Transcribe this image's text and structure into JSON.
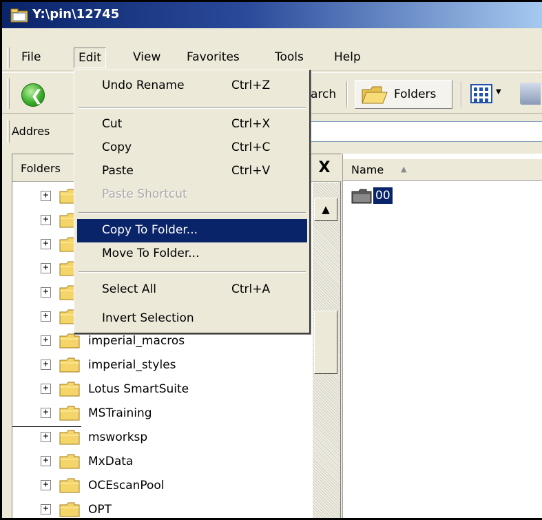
{
  "window": {
    "title": "Y:\\pin\\12745",
    "icon": "folder-window-icon"
  },
  "menubar": {
    "items": [
      "File",
      "Edit",
      "View",
      "Favorites",
      "Tools",
      "Help"
    ],
    "active": "Edit"
  },
  "toolbar": {
    "back_icon": "back-arrow-icon",
    "back_label_fragment": "",
    "search_fragment": "arch",
    "folders_label": "Folders",
    "views_icon": "views-icon"
  },
  "address": {
    "label": "Addres",
    "value": ""
  },
  "folders_pane": {
    "title": "Folders",
    "close_glyph": "X",
    "items": [
      {
        "label": "",
        "expander": "+"
      },
      {
        "label": "",
        "expander": "+"
      },
      {
        "label": "",
        "expander": "+"
      },
      {
        "label": "",
        "expander": "+"
      },
      {
        "label": "",
        "expander": "+"
      },
      {
        "label": "",
        "expander": "+"
      },
      {
        "label": "imperial_macros",
        "expander": "+"
      },
      {
        "label": "imperial_styles",
        "expander": "+"
      },
      {
        "label": "Lotus SmartSuite",
        "expander": "+"
      },
      {
        "label": "MSTraining",
        "expander": "+"
      },
      {
        "label": "msworksp",
        "expander": "+"
      },
      {
        "label": "MxData",
        "expander": "+"
      },
      {
        "label": "OCEscanPool",
        "expander": "+"
      },
      {
        "label": "OPT",
        "expander": "+"
      }
    ]
  },
  "content_pane": {
    "column_name": "Name",
    "items": [
      {
        "label": "00",
        "selected": true
      }
    ]
  },
  "edit_menu": {
    "items": [
      {
        "label": "Undo Rename",
        "shortcut": "Ctrl+Z",
        "disabled": false
      },
      {
        "separator": true
      },
      {
        "label": "Cut",
        "shortcut": "Ctrl+X",
        "disabled": false
      },
      {
        "label": "Copy",
        "shortcut": "Ctrl+C",
        "disabled": false
      },
      {
        "label": "Paste",
        "shortcut": "Ctrl+V",
        "disabled": false
      },
      {
        "label": "Paste Shortcut",
        "shortcut": "",
        "disabled": true
      },
      {
        "separator": true
      },
      {
        "label": "Copy To Folder...",
        "shortcut": "",
        "disabled": false,
        "highlighted": true
      },
      {
        "label": "Move To Folder...",
        "shortcut": "",
        "disabled": false
      },
      {
        "separator": true
      },
      {
        "label": "Select All",
        "shortcut": "Ctrl+A",
        "disabled": false
      },
      {
        "label": "Invert Selection",
        "shortcut": "",
        "disabled": false
      }
    ]
  },
  "colors": {
    "titlebar_start": "#0a246a",
    "titlebar_end": "#a6caf0",
    "menu_bg": "#ece9d8",
    "highlight": "#0a246a",
    "folder_yellow": "#f5d56a"
  }
}
